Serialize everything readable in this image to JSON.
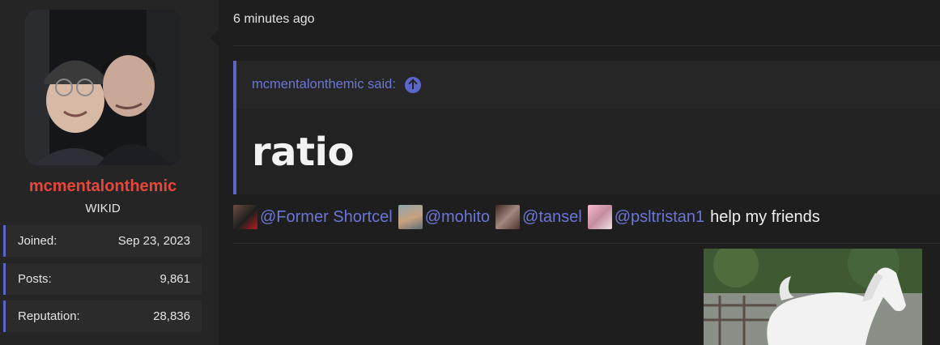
{
  "user": {
    "username": "mcmentalonthemic",
    "title": "WIKID",
    "stats": [
      {
        "label": "Joined:",
        "value": "Sep 23, 2023"
      },
      {
        "label": "Posts:",
        "value": "9,861"
      },
      {
        "label": "Reputation:",
        "value": "28,836"
      }
    ]
  },
  "post": {
    "time": "6 minutes ago",
    "quote": {
      "author_line": "mcmentalonthemic said:",
      "text": "ratio"
    },
    "mentions": [
      "@Former Shortcel",
      "@mohito",
      "@tansel",
      "@psltristan1"
    ],
    "message_tail": "help my friends"
  },
  "colors": {
    "accent": "#5c66c9",
    "link": "#6b76d6",
    "username": "#e8463a"
  }
}
